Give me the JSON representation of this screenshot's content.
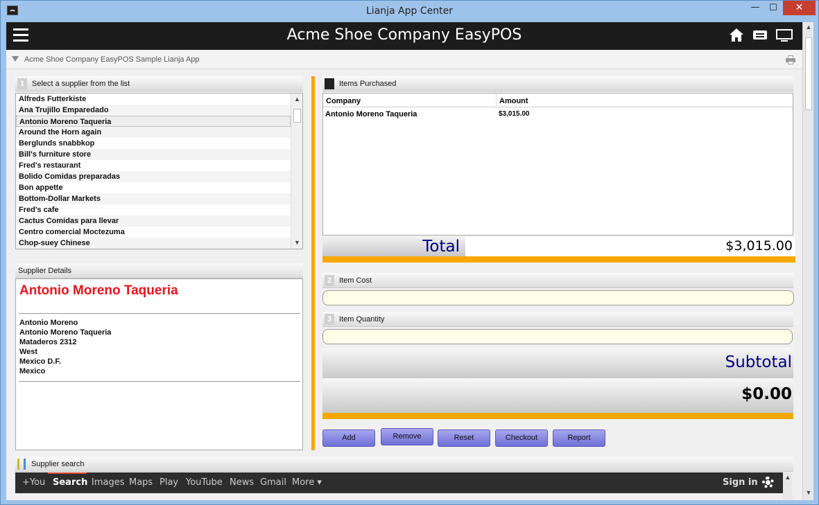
{
  "window": {
    "title": "Lianja App Center",
    "controls": {
      "minimize": "—",
      "maximize": "☐",
      "close": "✕"
    }
  },
  "app": {
    "title": "Acme Shoe Company EasyPOS",
    "breadcrumb": "Acme Shoe Company EasyPOS Sample Lianja App",
    "header_icons": [
      "home-icon",
      "message-icon",
      "screen-icon"
    ]
  },
  "supplier_list": {
    "number": "1",
    "label": "Select a supplier from the list",
    "selected_index": 2,
    "items": [
      "Alfreds Futterkiste",
      "Ana Trujillo Emparedado",
      "Antonio Moreno Taqueria",
      "Around the Horn again",
      "Berglunds snabbkop",
      "Bill's furniture store",
      "Fred's restaurant",
      "Bolido Comidas preparadas",
      "Bon appette",
      "Bottom-Dollar Markets",
      "Fred's cafe",
      "Cactus Comidas para llevar",
      "Centro comercial Moctezuma",
      "Chop-suey Chinese"
    ]
  },
  "supplier_details": {
    "label": "Supplier Details",
    "name": "Antonio Moreno Taqueria",
    "address": [
      "Antonio Moreno",
      "Antonio Moreno Taqueria",
      "Mataderos 2312",
      "West",
      "Mexico D.F.",
      "Mexico"
    ]
  },
  "items_purchased": {
    "label": "Items Purchased",
    "columns": [
      "Company",
      "Amount"
    ],
    "rows": [
      {
        "company": "Antonio Moreno Taqueria",
        "amount": "$3,015.00"
      }
    ],
    "total_label": "Total",
    "total_value": "$3,015.00"
  },
  "item_cost": {
    "number": "2",
    "label": "Item Cost",
    "value": ""
  },
  "item_quantity": {
    "number": "3",
    "label": "Item Quantity",
    "value": ""
  },
  "subtotal": {
    "label": "Subtotal",
    "value": "$0.00"
  },
  "buttons": {
    "add": "Add",
    "remove": "Remove",
    "reset": "Reset",
    "checkout": "Checkout",
    "report": "Report"
  },
  "supplier_search": {
    "label": "Supplier search",
    "nav": [
      "+You",
      "Search",
      "Images",
      "Maps",
      "Play",
      "YouTube",
      "News",
      "Gmail",
      "More ▾"
    ],
    "active": "Search",
    "sign_in": "Sign in"
  },
  "colors": {
    "accent_orange": "#f5a800",
    "details_name_red": "#e8141b",
    "total_blue": "#000080",
    "button_purple": "#8a8ae4"
  }
}
